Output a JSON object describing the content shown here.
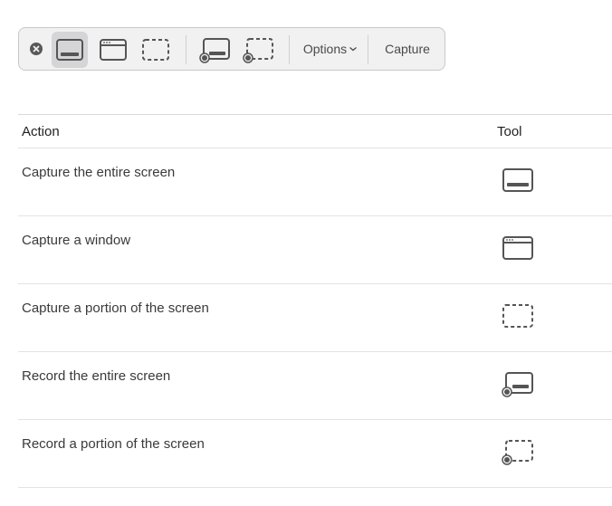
{
  "toolbar": {
    "close": "close-icon",
    "buttons": [
      {
        "icon": "capture-entire-screen-icon",
        "selected": true
      },
      {
        "icon": "capture-window-icon",
        "selected": false
      },
      {
        "icon": "capture-selection-icon",
        "selected": false
      },
      {
        "icon": "record-entire-screen-icon",
        "selected": false
      },
      {
        "icon": "record-selection-icon",
        "selected": false
      }
    ],
    "options_label": "Options",
    "capture_label": "Capture"
  },
  "table": {
    "headers": {
      "action": "Action",
      "tool": "Tool"
    },
    "rows": [
      {
        "action": "Capture the entire screen",
        "icon": "capture-entire-screen-icon"
      },
      {
        "action": "Capture a window",
        "icon": "capture-window-icon"
      },
      {
        "action": "Capture a portion of the screen",
        "icon": "capture-selection-icon"
      },
      {
        "action": "Record the entire screen",
        "icon": "record-entire-screen-icon"
      },
      {
        "action": "Record a portion of the screen",
        "icon": "record-selection-icon"
      }
    ]
  },
  "colors": {
    "toolbar_bg": "#f1f1f2",
    "selected_bg": "#d5d5d7",
    "icon": "#555555"
  }
}
